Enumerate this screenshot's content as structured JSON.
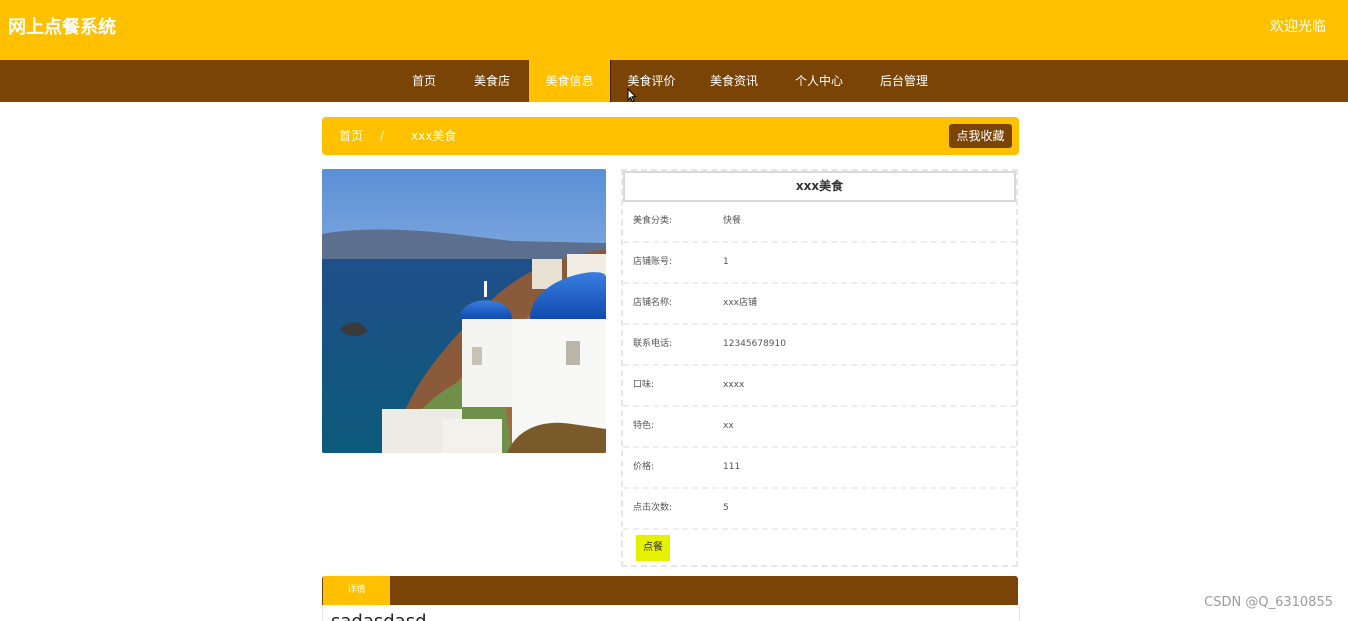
{
  "header": {
    "site_title": "网上点餐系统",
    "welcome": "欢迎光临",
    "bg_color": "#ffc000"
  },
  "nav": {
    "bg_color": "#7a4407",
    "items": [
      {
        "label": "首页"
      },
      {
        "label": "美食店"
      },
      {
        "label": "美食信息",
        "active": true
      },
      {
        "label": "美食评价"
      },
      {
        "label": "美食资讯"
      },
      {
        "label": "个人中心"
      },
      {
        "label": "后台管理"
      }
    ]
  },
  "breadcrumb": {
    "home": "首页",
    "separator": "/",
    "current": "xxx美食"
  },
  "favorite_button": "点我收藏",
  "product": {
    "image_icon": "santorini-photo",
    "title": "xxx美食",
    "fields": [
      {
        "label": "美食分类:",
        "value": "快餐"
      },
      {
        "label": "店铺账号:",
        "value": "1"
      },
      {
        "label": "店铺名称:",
        "value": "xxx店铺"
      },
      {
        "label": "联系电话:",
        "value": "12345678910"
      },
      {
        "label": "口味:",
        "value": "xxxx"
      },
      {
        "label": "特色:",
        "value": "xx"
      },
      {
        "label": "价格:",
        "value": "111"
      },
      {
        "label": "点击次数:",
        "value": "5"
      }
    ],
    "order_button": "点餐"
  },
  "detail": {
    "tab_label": "详情",
    "content": "sadasdasd"
  },
  "watermark": "CSDN @Q_6310855"
}
